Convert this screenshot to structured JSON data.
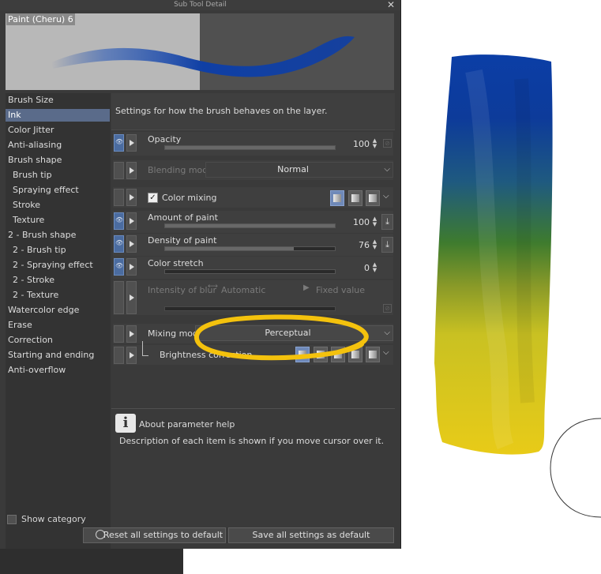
{
  "window": {
    "title": "Sub Tool Detail",
    "close_glyph": "✕"
  },
  "preview": {
    "brush_name": "Paint (Cheru) 6"
  },
  "sidebar": {
    "items": [
      {
        "label": "Brush Size"
      },
      {
        "label": "Ink"
      },
      {
        "label": "Color Jitter"
      },
      {
        "label": "Anti-aliasing"
      },
      {
        "label": "Brush shape"
      },
      {
        "label": "Brush tip"
      },
      {
        "label": "Spraying effect"
      },
      {
        "label": "Stroke"
      },
      {
        "label": "Texture"
      },
      {
        "label": "2 - Brush shape"
      },
      {
        "label": "2 - Brush tip"
      },
      {
        "label": "2 - Spraying effect"
      },
      {
        "label": "2 - Stroke"
      },
      {
        "label": "2 - Texture"
      },
      {
        "label": "Watercolor edge"
      },
      {
        "label": "Erase"
      },
      {
        "label": "Correction"
      },
      {
        "label": "Starting and ending"
      },
      {
        "label": "Anti-overflow"
      }
    ],
    "selected": "Ink",
    "show_category": "Show category"
  },
  "panel": {
    "description": "Settings for how the brush behaves on the layer.",
    "opacity": {
      "label": "Opacity",
      "value": "100",
      "level": 1.0
    },
    "blending_mode": {
      "label": "Blending mode",
      "value": "Normal"
    },
    "color_mixing": {
      "label": "Color mixing",
      "checked": true
    },
    "amount_of_paint": {
      "label": "Amount of paint",
      "value": "100",
      "level": 1.0
    },
    "density_of_paint": {
      "label": "Density of paint",
      "value": "76",
      "level": 0.76
    },
    "color_stretch": {
      "label": "Color stretch",
      "value": "0",
      "level": 0.0
    },
    "intensity_of_blur": {
      "label": "Intensity of blur",
      "automatic": "Automatic",
      "fixed_value": "Fixed value"
    },
    "mixing_mode": {
      "label": "Mixing mode",
      "value": "Perceptual"
    },
    "brightness_correction": {
      "label": "Brightness correction"
    }
  },
  "help": {
    "title": "About parameter help",
    "description": "Description of each item is shown if you move cursor over it."
  },
  "buttons": {
    "reset": "Reset all settings to default",
    "save": "Save all settings as default"
  },
  "colors": {
    "accent": "#5a6b8a",
    "toggle_on": "#4b6ca0",
    "annotation": "#f4c20d",
    "paint_blue": "#0f3fa5",
    "paint_yellow": "#e7c81e",
    "paint_green": "#3d7a2f"
  }
}
